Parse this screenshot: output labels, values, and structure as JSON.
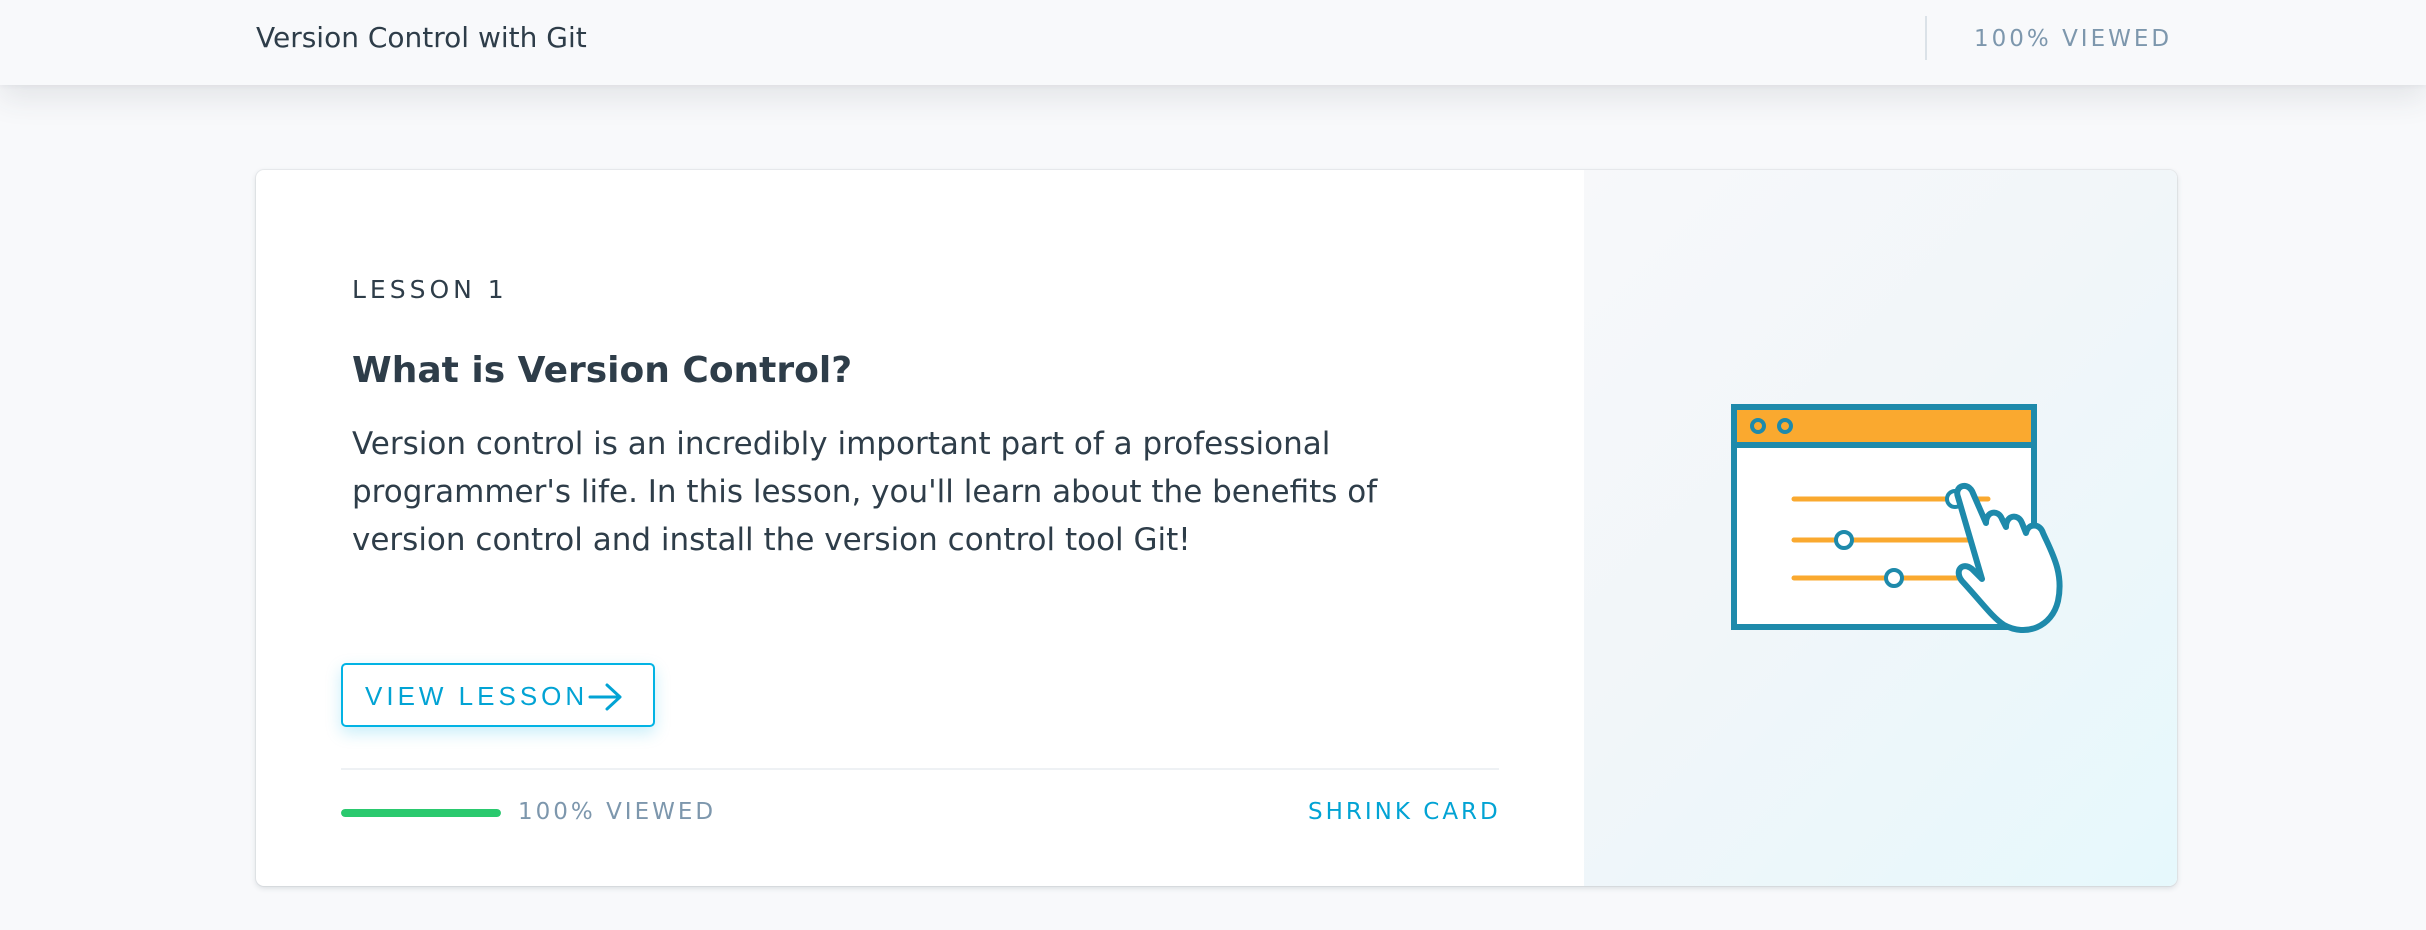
{
  "header": {
    "course_title": "Version Control with Git",
    "progress_label": "100% VIEWED"
  },
  "lesson_card": {
    "lesson_number": "LESSON 1",
    "title": "What is Version Control?",
    "description": "Version control is an incredibly important part of a professional programmer's life. In this lesson, you'll learn about the benefits of version control and install the version control tool Git!",
    "view_button_label": "VIEW LESSON",
    "view_button_icon": "arrow-right-icon",
    "progress": {
      "percent_viewed": 100,
      "label": "100% VIEWED"
    },
    "shrink_label": "SHRINK CARD",
    "illustration_icon": "browser-sliders-hand-icon"
  },
  "colors": {
    "accent_blue": "#02b3e4",
    "progress_green": "#2ac96e",
    "illustration_orange": "#faa92f",
    "illustration_teal": "#1e8aab",
    "text_dark": "#2e3d49",
    "text_muted": "#7d97ad"
  }
}
